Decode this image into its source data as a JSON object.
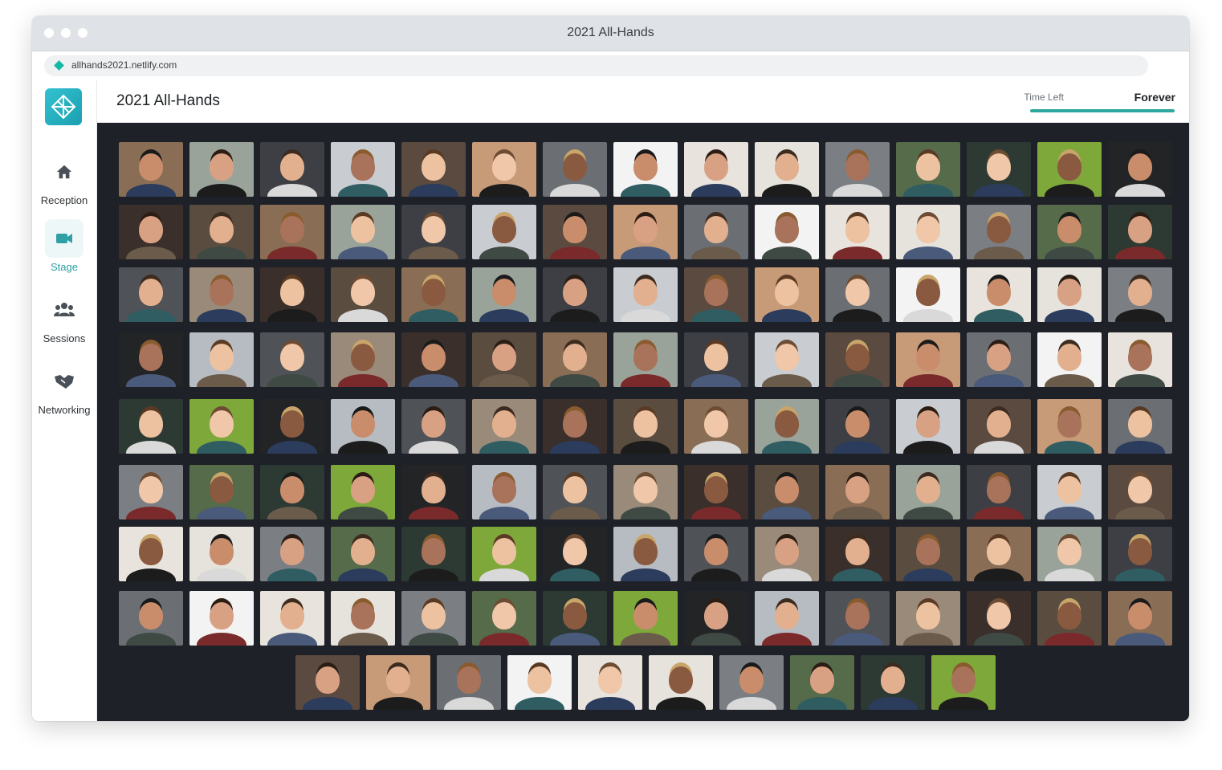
{
  "window": {
    "title": "2021 All-Hands"
  },
  "address": {
    "url": "allhands2021.netlify.com"
  },
  "sidebar": {
    "items": [
      {
        "label": "Reception",
        "icon": "home-icon",
        "active": false
      },
      {
        "label": "Stage",
        "icon": "video-camera-icon",
        "active": true
      },
      {
        "label": "Sessions",
        "icon": "group-icon",
        "active": false
      },
      {
        "label": "Networking",
        "icon": "handshake-icon",
        "active": false
      }
    ]
  },
  "header": {
    "title": "2021 All-Hands",
    "time_left_label": "Time Left",
    "time_left_value": "Forever"
  },
  "colors": {
    "accent": "#2ea89e",
    "stage_bg": "#1f2128",
    "titlebar": "#dfe2e6"
  },
  "stage": {
    "participant_rows": [
      15,
      15,
      15,
      15,
      15,
      15,
      15,
      15,
      10
    ]
  }
}
